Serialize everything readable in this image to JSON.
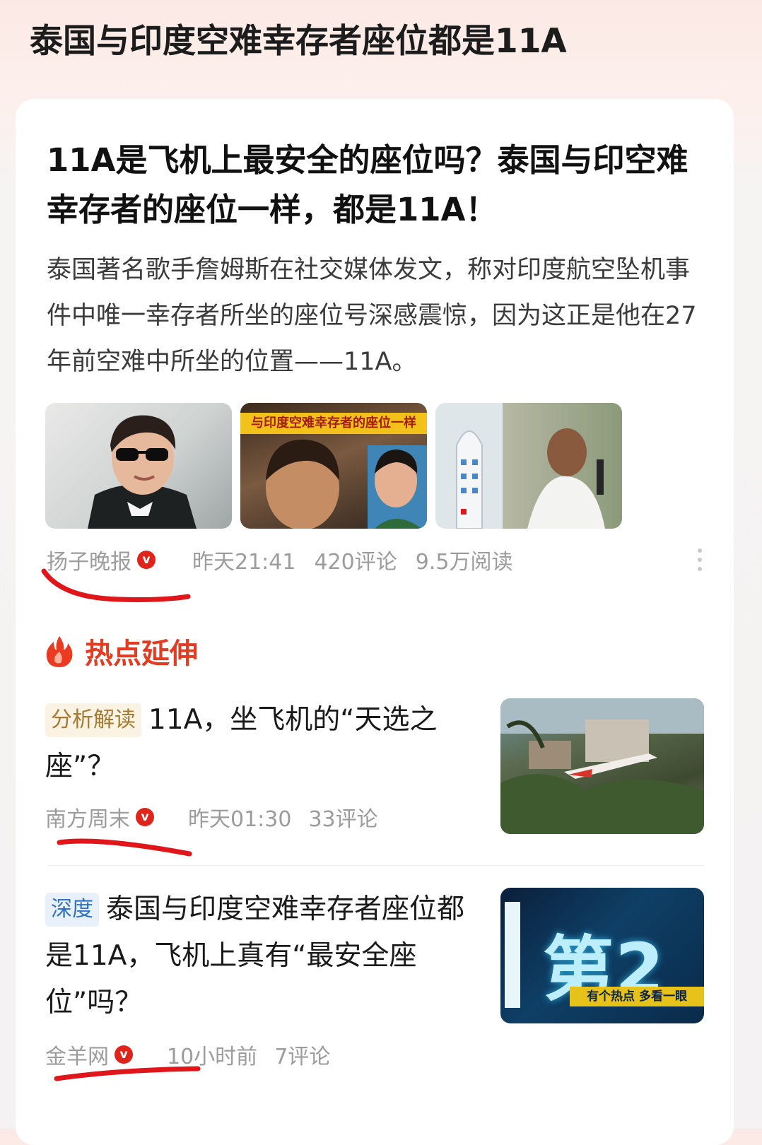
{
  "page": {
    "title": "泰国与印度空难幸存者座位都是11A"
  },
  "article": {
    "headline": "11A是飞机上最安全的座位吗？泰国与印空难幸存者的座位一样，都是11A！",
    "summary": "泰国著名歌手詹姆斯在社交媒体发文，称对印度航空坠机事件中唯一幸存者所坐的座位号深感震惊，因为这正是他在27年前空难中所坐的位置——11A。",
    "thumb_2_caption": "与印度空难幸存者的座位一样",
    "meta": {
      "source": "扬子晚报",
      "verified_mark": "v",
      "time": "昨天21:41",
      "comments": "420评论",
      "reads": "9.5万阅读"
    }
  },
  "hot_section": {
    "title": "热点延伸",
    "items": [
      {
        "tag": "分析解读",
        "title": "11A，坐飞机的“天选之座”？",
        "source": "南方周末",
        "verified_mark": "v",
        "time": "昨天01:30",
        "comments": "33评论"
      },
      {
        "tag": "深度",
        "title": "泰国与印度空难幸存者座位都是11A，飞机上真有“最安全座位”吗？",
        "source": "金羊网",
        "verified_mark": "v",
        "time": "10小时前",
        "comments": "7评论",
        "thumb_text": "第2",
        "thumb_bar": "有个热点 多看一眼"
      }
    ]
  },
  "colors": {
    "accent_red": "#e23c22",
    "verified_badge": "#e0231b",
    "annotation_marker": "#e0161b"
  }
}
